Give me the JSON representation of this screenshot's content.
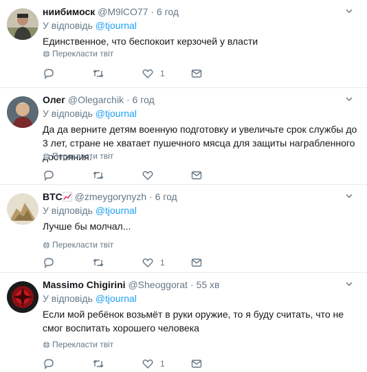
{
  "colors": {
    "accent": "#1da1f2",
    "muted": "#657786",
    "text": "#14171a",
    "divider": "#e6ecf0"
  },
  "reply_prefix": "У відповідь",
  "translate_label": "Перекласти твіт",
  "icons": [
    "reply-icon",
    "retweet-icon",
    "like-icon",
    "direct-message-icon",
    "chevron-down-icon",
    "globe-icon"
  ],
  "tweets": [
    {
      "name": "ниибимоск",
      "handle": "@M9lCO77",
      "separator": "·",
      "time": "6 год",
      "reply_to": "@tjournal",
      "text": "Единственное, что беспокоит керзочей у власти",
      "likes": "1"
    },
    {
      "name": "Олег",
      "handle": "@Olegarchik",
      "separator": "·",
      "time": "6 год",
      "reply_to": "@tjournal",
      "text": "Да да верните детям военную подготовку и увеличьте срок службы до 3 лет, стране не хватает пушечного мясца для защиты награбленного достояния.",
      "likes": ""
    },
    {
      "name": "BTC",
      "handle": "@zmeygorynyzh",
      "separator": "·",
      "time": "6 год",
      "reply_to": "@tjournal",
      "text": "Лучше бы молчал...",
      "likes": "1"
    },
    {
      "name": "Massimo Chigirini",
      "handle": "@Sheoggorat",
      "separator": "·",
      "time": "55 хв",
      "reply_to": "@tjournal",
      "text": "Если мой ребёнок возьмёт в руки оружие, то я буду считать, что не смог воспитать хорошего человека",
      "likes": "1"
    }
  ]
}
